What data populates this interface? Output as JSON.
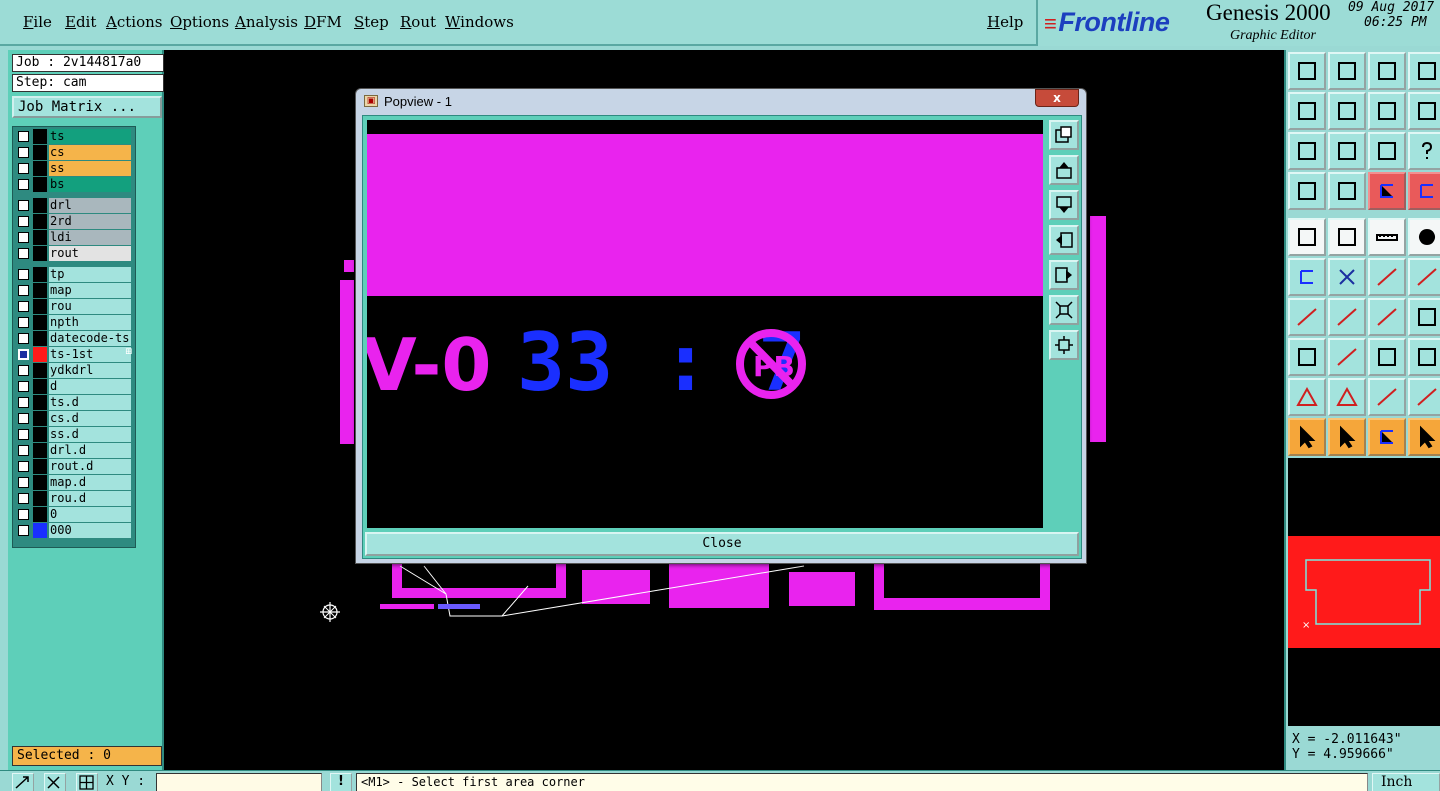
{
  "menu": {
    "items": [
      "File",
      "Edit",
      "Actions",
      "Options",
      "Analysis",
      "DFM",
      "Step",
      "Rout",
      "Windows"
    ],
    "help": "Help"
  },
  "brand": {
    "logo": "Frontline",
    "product": "Genesis 2000",
    "subtitle": "Graphic Editor",
    "date": "09 Aug 2017",
    "time": "06:25 PM"
  },
  "job": {
    "job_line": "Job : 2v144817a0",
    "step_line": "Step: cam",
    "matrix_button": "Job Matrix ..."
  },
  "layers": [
    {
      "name": "ts",
      "color": "#13a07e",
      "swatch": "#000000"
    },
    {
      "name": "cs",
      "color": "#f5b44a",
      "swatch": "#000000"
    },
    {
      "name": "ss",
      "color": "#f5b44a",
      "swatch": "#000000"
    },
    {
      "name": "bs",
      "color": "#13a07e",
      "swatch": "#000000"
    },
    {
      "name": "drl",
      "color": "#a9b7bd",
      "swatch": "#000000"
    },
    {
      "name": "2rd",
      "color": "#a9b7bd",
      "swatch": "#000000"
    },
    {
      "name": "ldi",
      "color": "#a9b7bd",
      "swatch": "#000000"
    },
    {
      "name": "rout",
      "color": "#e3e3e3",
      "swatch": "#000000"
    },
    {
      "name": "tp",
      "color": "#a3e3dd",
      "swatch": "#000000"
    },
    {
      "name": "map",
      "color": "#a3e3dd",
      "swatch": "#000000"
    },
    {
      "name": "rou",
      "color": "#a3e3dd",
      "swatch": "#000000"
    },
    {
      "name": "npth",
      "color": "#a3e3dd",
      "swatch": "#000000"
    },
    {
      "name": "datecode-ts",
      "color": "#a3e3dd",
      "swatch": "#000000"
    },
    {
      "name": "ts-1st",
      "color": "#a3e3dd",
      "swatch": "#ff1a1a",
      "active": true
    },
    {
      "name": "ydkdrl",
      "color": "#a3e3dd",
      "swatch": "#000000"
    },
    {
      "name": "d",
      "color": "#a3e3dd",
      "swatch": "#000000"
    },
    {
      "name": "ts.d",
      "color": "#a3e3dd",
      "swatch": "#000000"
    },
    {
      "name": "cs.d",
      "color": "#a3e3dd",
      "swatch": "#000000"
    },
    {
      "name": "ss.d",
      "color": "#a3e3dd",
      "swatch": "#000000"
    },
    {
      "name": "drl.d",
      "color": "#a3e3dd",
      "swatch": "#000000"
    },
    {
      "name": "rout.d",
      "color": "#a3e3dd",
      "swatch": "#000000"
    },
    {
      "name": "map.d",
      "color": "#a3e3dd",
      "swatch": "#000000"
    },
    {
      "name": "rou.d",
      "color": "#a3e3dd",
      "swatch": "#000000"
    },
    {
      "name": "0",
      "color": "#a3e3dd",
      "swatch": "#000000"
    },
    {
      "name": "000",
      "color": "#a3e3dd",
      "swatch": "#1a2fff"
    }
  ],
  "selected": "Selected : 0",
  "popview": {
    "title": "Popview - 1",
    "close_x": "x",
    "close_button": "Close",
    "text_magenta": "V-0",
    "text_blue": "33 : 7",
    "logo_text": "PB"
  },
  "coords": {
    "x": "X = -2.011643\"",
    "y": "Y = 4.959666\""
  },
  "bottom": {
    "xy_label": "X Y :",
    "xy_value": "",
    "bang": "!",
    "status": "<M1> - Select first area corner",
    "units": "Inch"
  },
  "colors": {
    "magenta": "#e923ee",
    "blue": "#1a2fff",
    "red": "#ff1a1a",
    "teal": "#5ecfb9"
  }
}
